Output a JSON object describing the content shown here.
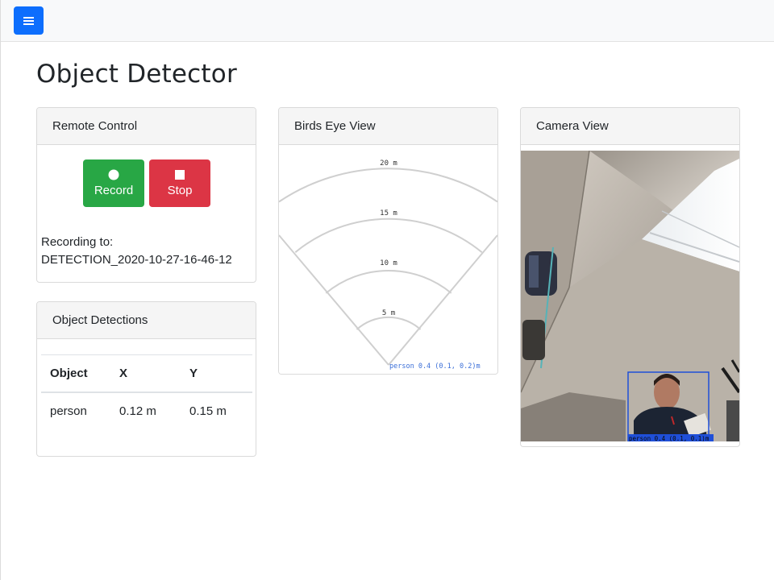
{
  "app": {
    "title": "Object Detector"
  },
  "navbar": {
    "menu_icon": "hamburger-icon",
    "accent": "#0d6efd"
  },
  "remote_control": {
    "header": "Remote Control",
    "record_label": "Record",
    "record_icon": "record-dot-icon",
    "stop_label": "Stop",
    "stop_icon": "stop-square-icon",
    "recording_prefix": "Recording to:",
    "recording_file": "DETECTION_2020-10-27-16-46-12",
    "colors": {
      "record": "#28a745",
      "stop": "#dc3545"
    }
  },
  "detections": {
    "header": "Object Detections",
    "columns": [
      "Object",
      "X",
      "Y"
    ],
    "rows": [
      {
        "object": "person",
        "x": "0.12 m",
        "y": "0.15 m"
      }
    ]
  },
  "birds_eye": {
    "header": "Birds Eye View",
    "rings": [
      "20 m",
      "15 m",
      "10 m",
      "5 m"
    ],
    "detection_label": "person 0.4 (0.1, 0.2)m"
  },
  "camera": {
    "header": "Camera View",
    "detection_label": "person 0.4 (0.1, 0.1)m",
    "box_color": "#1f4fd8"
  }
}
